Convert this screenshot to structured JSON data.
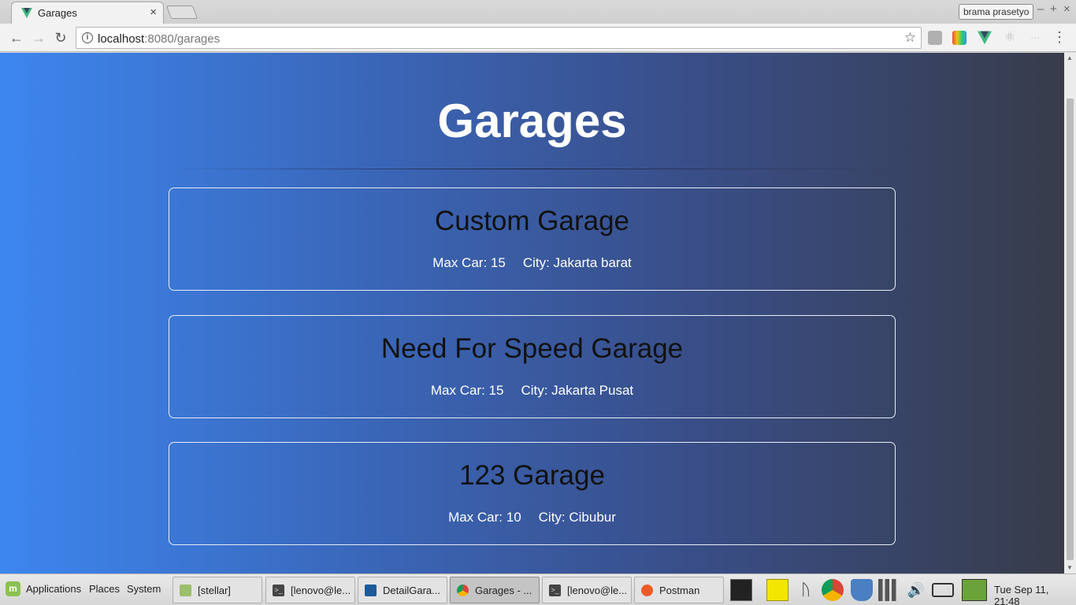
{
  "browser": {
    "tab_title": "Garages",
    "tab_close": "×",
    "profile_name": "brama prasetyo",
    "url_host": "localhost",
    "url_path": ":8080/garages"
  },
  "page": {
    "title": "Garages",
    "garages": [
      {
        "name": "Custom Garage",
        "max_car": "Max Car: 15",
        "city": "City: Jakarta barat"
      },
      {
        "name": "Need For Speed Garage",
        "max_car": "Max Car: 15",
        "city": "City: Jakarta Pusat"
      },
      {
        "name": "123 Garage",
        "max_car": "Max Car: 10",
        "city": "City: Cibubur"
      }
    ]
  },
  "taskbar": {
    "menus": [
      "Applications",
      "Places",
      "System"
    ],
    "windows": [
      {
        "label": "[stellar]",
        "icon": "folder-icon"
      },
      {
        "label": "[lenovo@le...",
        "icon": "terminal-icon"
      },
      {
        "label": "DetailGara...",
        "icon": "vscode-icon"
      },
      {
        "label": "Garages - ...",
        "icon": "chrome-icon",
        "active": true
      },
      {
        "label": "[lenovo@le...",
        "icon": "terminal-icon"
      },
      {
        "label": "Postman",
        "icon": "postman-icon"
      }
    ],
    "clock": "Tue Sep 11, 21:48"
  },
  "colors": {
    "vue_green": "#41b883",
    "vue_dark": "#35495e",
    "gradient_start": "#3d86ef",
    "gradient_end": "#383c4a"
  }
}
